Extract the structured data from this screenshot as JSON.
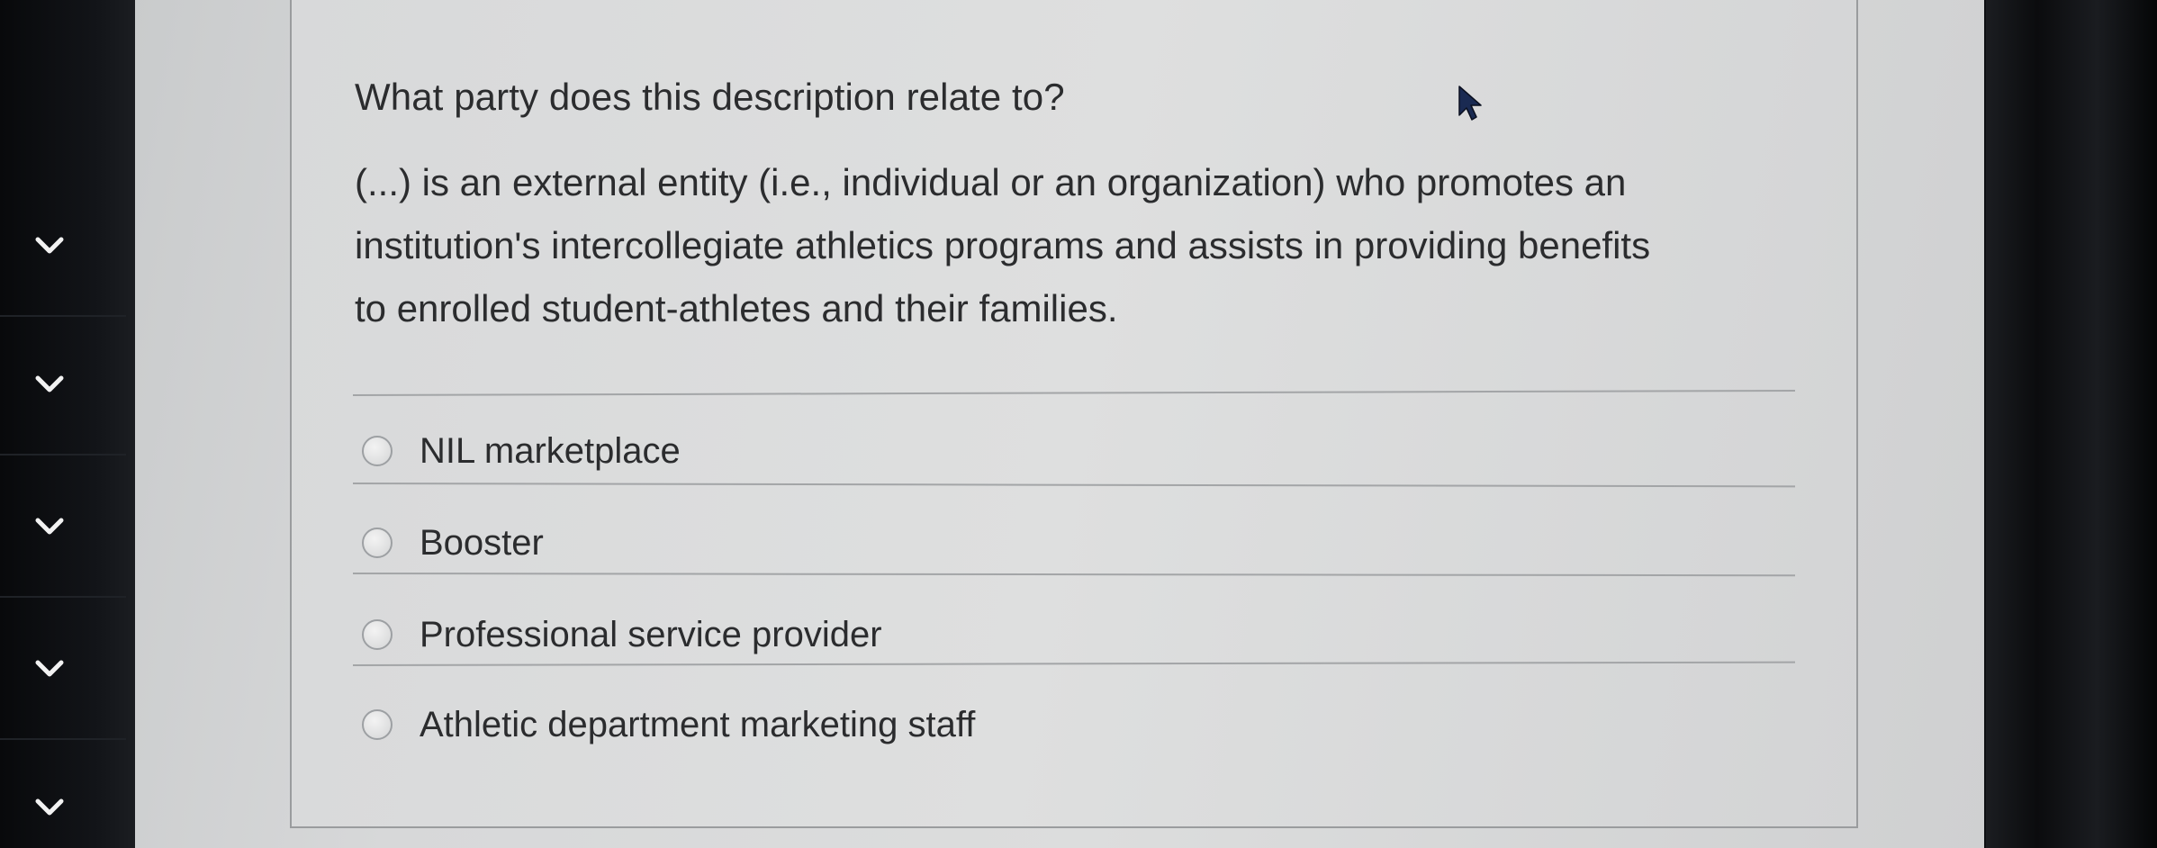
{
  "question": {
    "title": "What party does this description relate to?",
    "description_lines": [
      "(...) is an external entity (i.e., individual or an organization) who promotes an",
      "institution's intercollegiate athletics programs and assists in providing benefits",
      "to enrolled student-athletes and their families."
    ]
  },
  "options": [
    {
      "label": "NIL marketplace",
      "selected": false
    },
    {
      "label": "Booster",
      "selected": false
    },
    {
      "label": "Professional service provider",
      "selected": false
    },
    {
      "label": "Athletic department marketing staff",
      "selected": false
    }
  ],
  "sidebar": {
    "chevron_icons": [
      "chevron-down-icon",
      "chevron-down-icon",
      "chevron-down-icon",
      "chevron-down-icon",
      "chevron-down-icon"
    ]
  },
  "colors": {
    "text": "#2b2c2e",
    "page": "#dcdddd",
    "rail": "#0d0f12"
  }
}
